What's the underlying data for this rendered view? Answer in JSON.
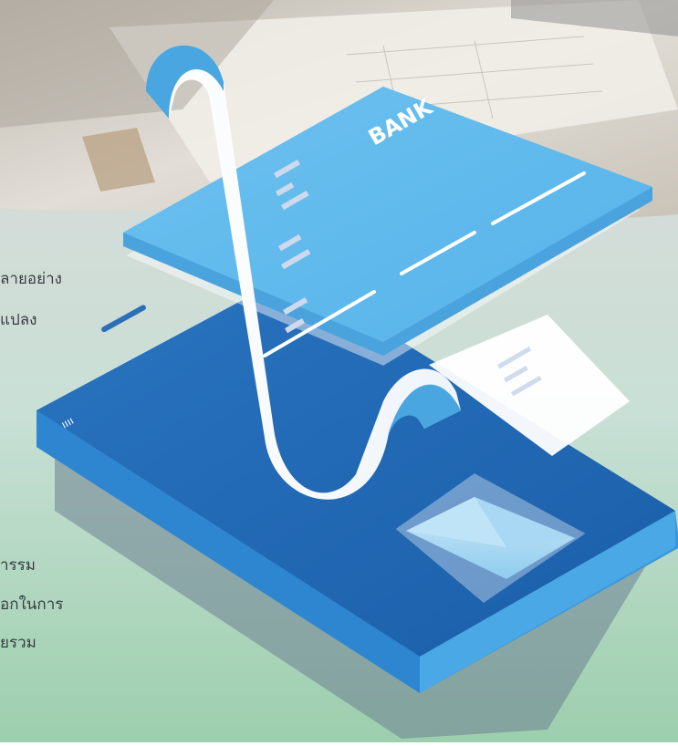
{
  "card": {
    "brand_label": "BANK"
  },
  "body_text": {
    "line_1": "ลายอย่าง",
    "line_2": "แปลง",
    "line_3": "ารรม",
    "line_4": "อกในการ",
    "line_5": "ยรวม"
  },
  "phone": {
    "status_glyph": "ıııı"
  },
  "colors": {
    "phone_blue": "#1f6fbe",
    "phone_side": "#2f8fd8",
    "card_blue": "#5ab7ec",
    "receipt_white": "#ffffff",
    "background_green": "#a9d3b7",
    "background_top": "#c9c5bd"
  },
  "icons": {
    "envelope": "envelope-icon",
    "receipt": "receipt-icon",
    "card": "credit-card-icon",
    "phone": "smartphone-icon"
  }
}
